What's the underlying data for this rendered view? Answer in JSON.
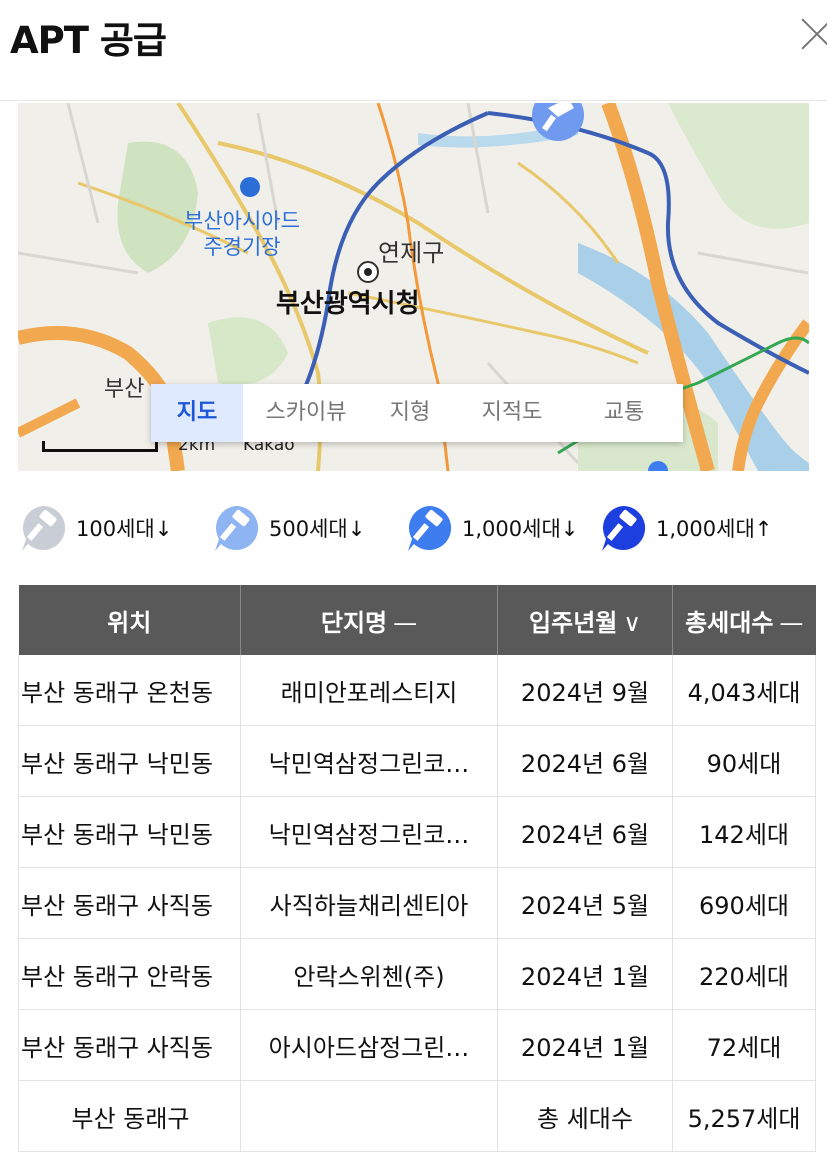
{
  "header": {
    "title": "APT 공급",
    "close_icon": "close-icon"
  },
  "map": {
    "labels": {
      "asiad_line1": "부산아시아드",
      "asiad_line2": "주경기장",
      "yeonje": "연제구",
      "city_hall": "부산광역시청",
      "busan_fragment": "부산"
    },
    "tabs": [
      "지도",
      "스카이뷰",
      "지형",
      "지적도",
      "교통"
    ],
    "active_tab": "지도",
    "scale_label": "2km",
    "provider": "Kakao"
  },
  "legend": [
    {
      "label": "100세대↓",
      "color": "#c9ced6",
      "icon": "hammer-pin-icon"
    },
    {
      "label": "500세대↓",
      "color": "#8fb4f2",
      "icon": "hammer-pin-icon"
    },
    {
      "label": "1,000세대↓",
      "color": "#3d7df0",
      "icon": "hammer-pin-icon"
    },
    {
      "label": "1,000세대↑",
      "color": "#1e3fe0",
      "icon": "hammer-pin-icon"
    }
  ],
  "table": {
    "headers": [
      {
        "label": "위치",
        "sort": ""
      },
      {
        "label": "단지명",
        "sort": "—"
      },
      {
        "label": "입주년월",
        "sort": "∨"
      },
      {
        "label": "총세대수",
        "sort": "—"
      }
    ],
    "rows": [
      [
        "부산 동래구 온천동",
        "래미안포레스티지",
        "2024년 9월",
        "4,043세대"
      ],
      [
        "부산 동래구 낙민동",
        "낙민역삼정그린코…",
        "2024년 6월",
        "90세대"
      ],
      [
        "부산 동래구 낙민동",
        "낙민역삼정그린코…",
        "2024년 6월",
        "142세대"
      ],
      [
        "부산 동래구 사직동",
        "사직하늘채리센티아",
        "2024년 5월",
        "690세대"
      ],
      [
        "부산 동래구 안락동",
        "안락스위첸(주)",
        "2024년 1월",
        "220세대"
      ],
      [
        "부산 동래구 사직동",
        "아시아드삼정그린…",
        "2024년 1월",
        "72세대"
      ]
    ],
    "total": {
      "location": "부산 동래구",
      "label": "총 세대수",
      "value": "5,257세대"
    }
  }
}
